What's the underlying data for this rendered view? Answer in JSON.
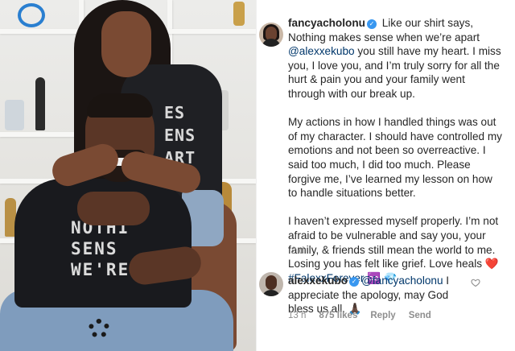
{
  "post": {
    "username": "fancyacholonu",
    "paragraphs": [
      {
        "lead": " Like our shirt says, Nothing makes sense when we’re apart ",
        "mention": "@alexxekubo",
        "rest": " you still have my heart. I miss you, I love you, and I’m truly sorry for all the hurt & pain you and your family went through with our break up."
      },
      {
        "text": "My actions in how I handled things was out of my character. I should have controlled my emotions and not been so overreactive. I said too much, I did too much. Please forgive me, I’ve learned my lesson on how to handle situations better."
      },
      {
        "text": "I haven’t expressed myself properly. I’m not afraid to be vulnerable and say you, your family, & friends still mean the world to me. Losing you has felt like grief. Love heals ",
        "heart": "❤️",
        "hashtag": "#FalexxForever",
        "emoji_end": " ♾️ ",
        "diamond": "💎"
      }
    ],
    "time": "2 d"
  },
  "comment": {
    "username": "alexxekubo",
    "mention": "@fancyacholonu",
    "text": " I appreciate the apology, may God bless us all. 🙏🏿",
    "time": "13 h",
    "likes": "875 likes",
    "reply_label": "Reply",
    "send_label": "Send"
  },
  "photo": {
    "man_shirt_text": "NOTHI SENS WE'RE",
    "woman_shirt_text": "ES ENS ART"
  },
  "colors": {
    "link": "#00376b",
    "verified": "#3897f0",
    "muted": "#8e8e8e",
    "heart": "#ed4956"
  }
}
